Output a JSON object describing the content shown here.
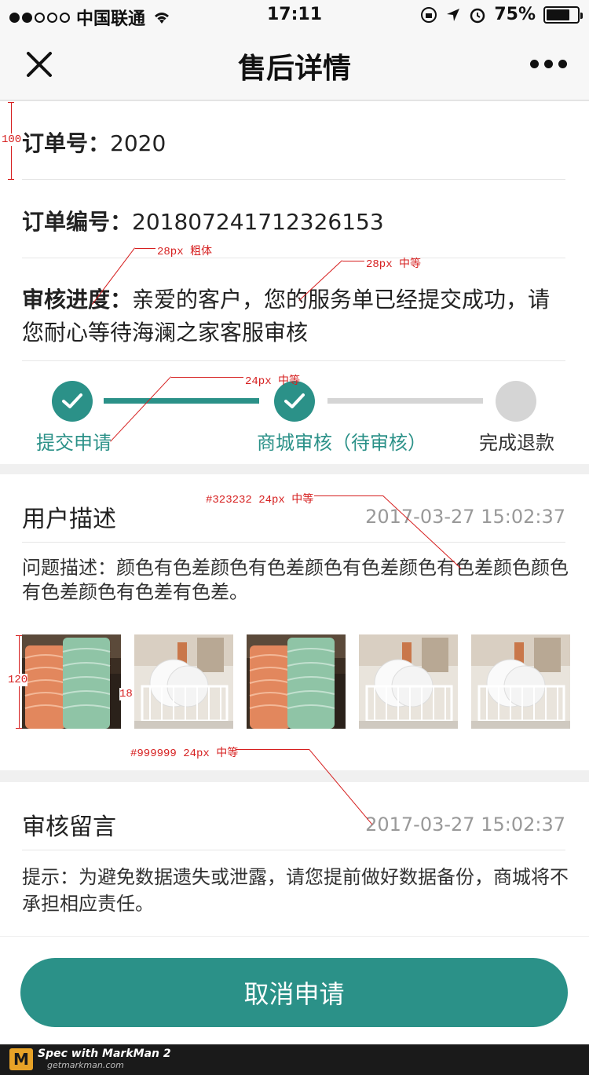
{
  "status_bar": {
    "carrier": "中国联通",
    "time": "17:11",
    "battery": "75%",
    "battery_level": 0.75
  },
  "nav": {
    "title": "售后详情"
  },
  "order": {
    "number_label": "订单号：",
    "number_value": "2020",
    "code_label": "订单编号：",
    "code_value": "20180724171232615​3",
    "review_label": "审核进度：",
    "review_value": "亲爱的客户，您的服务单已经提交成功，请您耐心等待海澜之家客服审核"
  },
  "progress": {
    "steps": [
      {
        "label": "提交申请",
        "status": "done"
      },
      {
        "label": "商城审核（待审核）",
        "status": "done"
      },
      {
        "label": "完成退款",
        "status": "todo"
      }
    ]
  },
  "user_desc": {
    "title": "用户描述",
    "time": "2017-03-27   15:02:37",
    "text": "问题描述：颜色有色差颜色有色差颜色有色差颜色有色差颜色颜色有色差颜色有色差有色差。",
    "images": [
      "towel-rolls",
      "dish-rack",
      "towel-rolls",
      "dish-rack",
      "dish-rack"
    ]
  },
  "review": {
    "title": "审核留言",
    "time": "2017-03-27   15:02:37",
    "text": "提示：为避免数据遗失或泄露，请您提前做好数据备份，商城将不承担相应责任。"
  },
  "cancel_button": "取消申请",
  "footer": {
    "line1": "Spec with MarkMan 2",
    "line2": "getmarkman.com",
    "logo": "M"
  },
  "annotations": {
    "a1": "100",
    "a2": "28px 粗体",
    "a3": "28px 中等",
    "a4": "24px 中等",
    "a5": "#323232 24px 中等",
    "a6": "120",
    "a7": "18",
    "a8": "#999999 24px 中等"
  },
  "colors": {
    "accent": "#2b9188",
    "inactive": "#d5d5d5",
    "text": "#323232",
    "muted": "#999999"
  }
}
